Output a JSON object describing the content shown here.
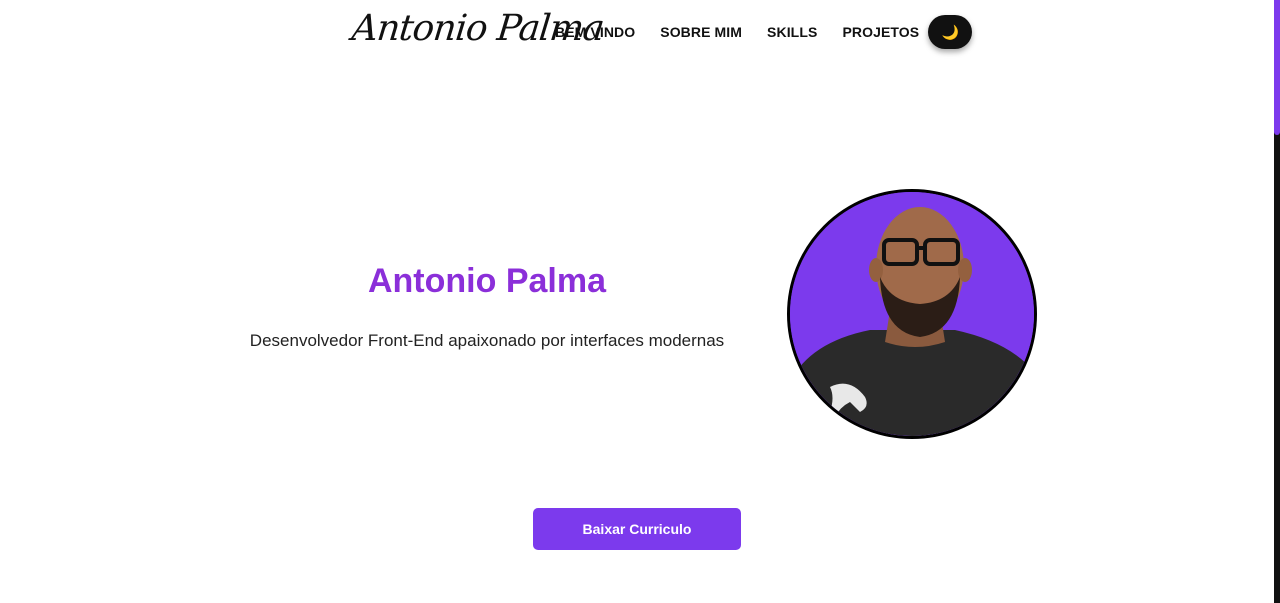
{
  "header": {
    "logo_text": "Antonio Palma",
    "nav_items": [
      {
        "label": "BEM VINDO"
      },
      {
        "label": "SOBRE MIM"
      },
      {
        "label": "SKILLS"
      },
      {
        "label": "PROJETOS"
      }
    ],
    "theme_toggle": {
      "icon": "moon-icon",
      "glyph": "🌙"
    }
  },
  "hero": {
    "name": "Antonio Palma",
    "subtitle": "Desenvolvedor Front-End apaixonado por interfaces modernas",
    "photo": {
      "subject": "profile-photo",
      "background_color": "#7c3aed"
    }
  },
  "cta": {
    "label": "Baixar Curriculo"
  },
  "colors": {
    "accent": "#7c3aed",
    "title": "#8b2fd9",
    "text": "#111111",
    "background": "#ffffff"
  }
}
